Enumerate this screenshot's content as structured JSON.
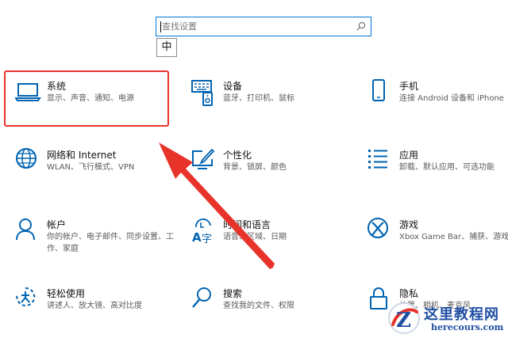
{
  "search": {
    "placeholder": "查找设置"
  },
  "ime": {
    "label": "中"
  },
  "tiles": [
    {
      "icon": "laptop-icon",
      "title": "系统",
      "desc": "显示、声音、通知、电源"
    },
    {
      "icon": "devices-icon",
      "title": "设备",
      "desc": "蓝牙、打印机、鼠标"
    },
    {
      "icon": "phone-icon",
      "title": "手机",
      "desc": "连接 Android 设备和 iPhone"
    },
    {
      "icon": "globe-icon",
      "title": "网络和 Internet",
      "desc": "WLAN、飞行模式、VPN"
    },
    {
      "icon": "personalization-icon",
      "title": "个性化",
      "desc": "背景、锁屏、颜色"
    },
    {
      "icon": "apps-icon",
      "title": "应用",
      "desc": "卸载、默认应用、可选功能"
    },
    {
      "icon": "person-icon",
      "title": "帐户",
      "desc": "你的帐户、电子邮件、同步设置、工作、家庭"
    },
    {
      "icon": "time-language-icon",
      "title": "时间和语言",
      "desc": "语音、区域、日期"
    },
    {
      "icon": "xbox-icon",
      "title": "游戏",
      "desc": "Xbox Game Bar、捕获、游戏模式"
    },
    {
      "icon": "ease-of-access-icon",
      "title": "轻松使用",
      "desc": "讲述人、放大镜、高对比度"
    },
    {
      "icon": "search-icon",
      "title": "搜索",
      "desc": "查找我的文件、权限"
    },
    {
      "icon": "lock-icon",
      "title": "隐私",
      "desc": "位置、相机、麦克风"
    }
  ],
  "watermark": {
    "title": "这里教程网",
    "url": "herecours.com",
    "logo_letter": "Z"
  },
  "colors": {
    "accent": "#0078d7",
    "highlight": "#e8332a",
    "watermark": "#1f4ea3"
  }
}
